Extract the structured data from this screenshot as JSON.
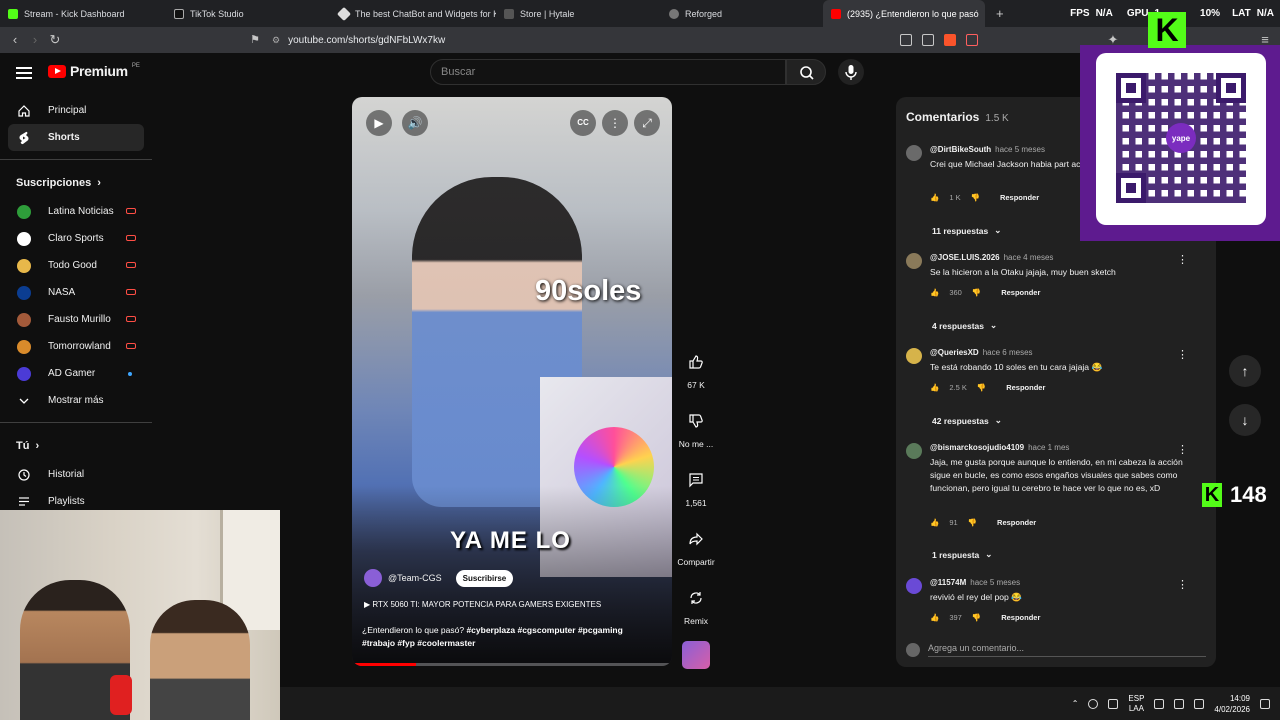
{
  "browser": {
    "tabs": [
      {
        "title": "Stream - Kick Dashboard",
        "color": "#53fc18"
      },
      {
        "title": "TikTok Studio",
        "color": "#111111"
      },
      {
        "title": "The best ChatBot and Widgets for Ki",
        "color": "#dddddd"
      },
      {
        "title": "Store | Hytale",
        "color": "#555555"
      },
      {
        "title": "Reforged",
        "color": "#777777"
      },
      {
        "title": "(2935) ¿Entendieron lo que pasó",
        "color": "#ff0000"
      }
    ],
    "new_tab": "+",
    "url": "youtube.com/shorts/gdNFbLWx7kw",
    "stats": {
      "fps_label": "FPS",
      "fps_value": "N/A",
      "gpu_label": "GPU",
      "gpu_value": "1",
      "pct": "10%",
      "lat_label": "LAT",
      "lat_value": "N/A"
    }
  },
  "youtube": {
    "logo_text": "Premium",
    "logo_region": "PE",
    "search_placeholder": "Buscar",
    "sidebar": {
      "main": [
        {
          "label": "Principal",
          "icon": "home-icon"
        },
        {
          "label": "Shorts",
          "icon": "shorts-icon"
        }
      ],
      "subs_title": "Suscripciones",
      "subs": [
        {
          "label": "Latina Noticias",
          "color": "#2e9d3a",
          "badge": "live"
        },
        {
          "label": "Claro Sports",
          "color": "#ffffff",
          "badge": "live"
        },
        {
          "label": "Todo Good",
          "color": "#e8b84a",
          "badge": "live"
        },
        {
          "label": "NASA",
          "color": "#0b3d91",
          "badge": "live"
        },
        {
          "label": "Fausto Murillo",
          "color": "#a35a3a",
          "badge": "live"
        },
        {
          "label": "Tomorrowland",
          "color": "#d98b2b",
          "badge": "live"
        },
        {
          "label": "AD Gamer",
          "color": "#4b3bd6",
          "badge": "new"
        }
      ],
      "show_more": "Mostrar más",
      "you_title": "Tú",
      "you_items": [
        {
          "label": "Historial",
          "icon": "history-icon"
        },
        {
          "label": "Playlists",
          "icon": "playlists-icon"
        }
      ]
    },
    "short": {
      "overlay_price": "90soles",
      "overlay_caption": "YA ME LO",
      "channel": "@Team-CGS",
      "subscribe": "Suscribirse",
      "song": "RTX 5060 TI: MAYOR POTENCIA PARA GAMERS EXIGENTES",
      "description_plain": "¿Entendieron lo que pasó?",
      "hashtags_1": "#cyberplaza #cgscomputer #pcgaming",
      "hashtags_2": "#trabajo #fyp #coolermaster",
      "progress": 0.2,
      "progress_color": "#ff0000"
    },
    "actions": {
      "likes": "67 K",
      "dislike": "No me ...",
      "comments": "1,561",
      "share": "Compartir",
      "remix": "Remix"
    },
    "comments_panel": {
      "title": "Comentarios",
      "count": "1.5 K",
      "items": [
        {
          "user": "@DirtBikeSouth",
          "time": "hace 5 meses",
          "text": "Crei que Michael Jackson habia part acostados.",
          "likes": "1 K",
          "reply": "Responder",
          "replies": "11 respuestas",
          "color": "#6a6a6a"
        },
        {
          "user": "@JOSE.LUIS.2026",
          "time": "hace 4 meses",
          "text": "Se la hicieron a la Otaku jajaja, muy buen sketch",
          "likes": "360",
          "reply": "Responder",
          "replies": "4 respuestas",
          "color": "#8a7a5a"
        },
        {
          "user": "@QueriesXD",
          "time": "hace 6 meses",
          "text": "Te está robando 10 soles en tu cara jajaja 😂",
          "likes": "2.5 K",
          "reply": "Responder",
          "replies": "42 respuestas",
          "color": "#d6b34a"
        },
        {
          "user": "@bismarckosojudio4109",
          "time": "hace 1 mes",
          "text": "Jaja, me gusta porque aunque lo entiendo, en mi cabeza la acción sigue en bucle, es como esos engaños visuales que sabes como funcionan, pero igual tu cerebro te hace ver lo que no es, xD",
          "likes": "91",
          "reply": "Responder",
          "replies": "1 respuesta",
          "color": "#5a7a5a"
        },
        {
          "user": "@11574M",
          "time": "hace 5 meses",
          "text": "revivió el rey del pop 😂",
          "likes": "397",
          "reply": "Responder",
          "replies": "",
          "color": "#6a4ad6"
        }
      ],
      "add_placeholder": "Agrega un comentario..."
    }
  },
  "stream_overlay": {
    "qr_brand": "yape",
    "viewer_count": "148",
    "kick_letter": "K"
  },
  "taskbar": {
    "lang_1": "ESP",
    "lang_2": "LAA",
    "time": "14:09",
    "date": "4/02/2026"
  }
}
